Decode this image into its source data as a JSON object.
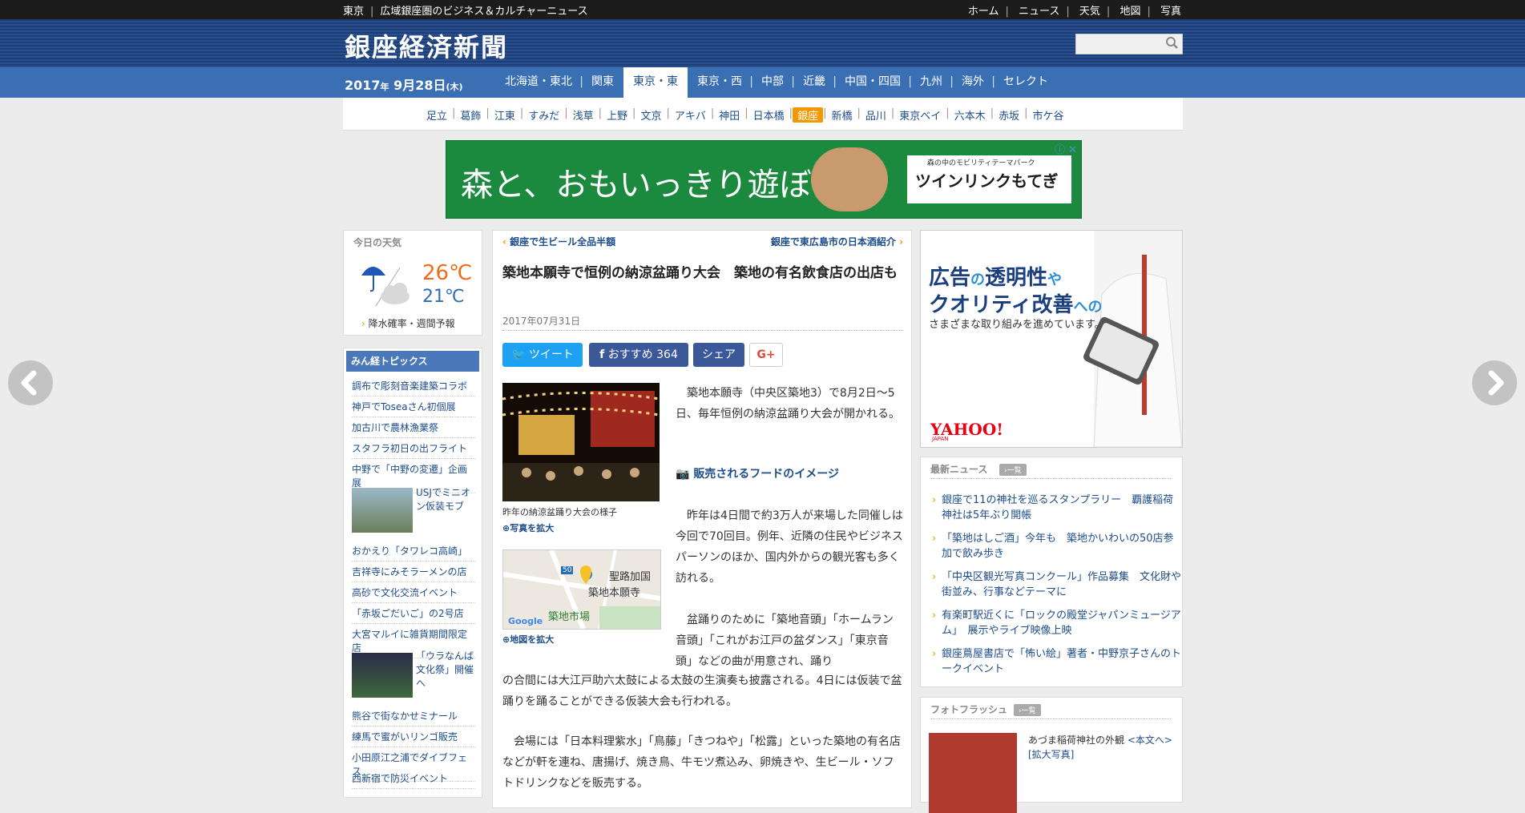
{
  "topbar": {
    "region": "東京",
    "tagline": "広域銀座圏のビジネス＆カルチャーニュース",
    "links": [
      "ホーム",
      "ニュース",
      "天気",
      "地図",
      "写真"
    ]
  },
  "site": {
    "title": "銀座経済新聞"
  },
  "date": {
    "year": "2017",
    "nen": "年",
    "md": " 9月28日",
    "dow": "(木)"
  },
  "regions": [
    "北海道・東北",
    "関東",
    "東京・東",
    "東京・西",
    "中部",
    "近畿",
    "中国・四国",
    "九州",
    "海外",
    "セレクト"
  ],
  "areas": [
    "足立",
    "葛飾",
    "江東",
    "すみだ",
    "浅草",
    "上野",
    "文京",
    "アキバ",
    "神田",
    "日本橋",
    "銀座",
    "新橋",
    "品川",
    "東京ベイ",
    "六本木",
    "赤坂",
    "市ケ谷"
  ],
  "banner": {
    "text": "森と、おもいっきり遊ぼう。",
    "sub": "森の中のモビリティテーマパーク",
    "brand": "ツインリンクもてぎ"
  },
  "weather": {
    "title": "今日の天気",
    "high": "26℃",
    "low": "21℃",
    "link": "降水確率・週間予報"
  },
  "topics": {
    "title": "みん経トピックス",
    "items_a": [
      "調布で彫刻音楽建築コラボ",
      "神戸でToseaさん初個展",
      "加古川で農林漁業祭",
      "スタフラ初日の出フライト",
      "中野で「中野の変遷」企画展"
    ],
    "img1": "USJでミニオン仮装モブ",
    "items_b": [
      "おかえり「タワレコ高崎」",
      "吉祥寺にみそラーメンの店",
      "高砂で文化交流イベント",
      "「赤坂ごだいご」の2号店",
      "大宮マルイに雑貨期間限定店"
    ],
    "img2": "「ウラなんば文化祭」開催へ",
    "items_c": [
      "熊谷で街なかせミナール",
      "練馬で蜜がいリンゴ販売",
      "小田原江之浦でダイブフェス",
      "西新宿で防災イベント"
    ]
  },
  "article": {
    "prev": "銀座で生ビール全品半額",
    "next": "銀座で東広島市の日本酒紹介",
    "title": "築地本願寺で恒例の納涼盆踊り大会　築地の有名飲食店の出店も",
    "date": "2017年07月31日",
    "tweet": "ツイート",
    "recommend": "おすすめ 364",
    "share": "シェア",
    "gplus": "G+",
    "photo_caption": "昨年の納涼盆踊り大会の様子",
    "photo_zoom": "写真を拡大",
    "map_zoom": "地図を拡大",
    "map_labels": [
      "聖路加国",
      "築地本願寺",
      "築地市場",
      "50",
      "Google"
    ],
    "p1": "　築地本願寺（中央区築地3）で8月2日～5日、毎年恒例の納涼盆踊り大会が開かれる。",
    "food_link": "販売されるフードのイメージ",
    "p2": "　昨年は4日間で約3万人が来場した同催しは今回で70回目。例年、近隣の住民やビジネスパーソンのほか、国内外からの観光客も多く訪れる。",
    "p3": "　盆踊りのために「築地音頭」「ホームラン音頭」「これがお江戸の盆ダンス」「東京音頭」などの曲が用意され、踊り",
    "p3b": "の合間には大江戸助六太鼓による太鼓の生演奏も披露される。4日には仮装で盆踊りを踊ることができる仮装大会も行われる。",
    "p4": "　会場には「日本料理紫水」「鳥藤」「きつねや」「松露」といった築地の有名店などが軒を連ね、唐揚げ、焼き鳥、牛モツ煮込み、卵焼きや、生ビール・ソフトドリンクなどを販売する。"
  },
  "ad": {
    "l1a": "広告",
    "l1b": "の",
    "l1c": "透明性",
    "l1d": "や",
    "l2a": "クオリティ改善",
    "l2b": "への",
    "l3": "さまざまな取り組みを進めています。",
    "brand": "YAHOO!",
    "brand_sub": "JAPAN"
  },
  "latest": {
    "title": "最新ニュース",
    "more": "一覧",
    "items": [
      "銀座で11の神社を巡るスタンプラリー　覇護稲荷神社は5年ぶり開帳",
      "「築地はしご酒」今年も　築地かいわいの50店参加で飲み歩き",
      "「中央区観光写真コンクール」作品募集　文化財や街並み、行事などテーマに",
      "有楽町駅近くに「ロックの殿堂ジャパンミュージアム」　展示やライブ映像上映",
      "銀座蔦屋書店で「怖い絵」著者・中野京子さんのトークイベント"
    ]
  },
  "photoflash": {
    "title": "フォトフラッシュ",
    "more": "一覧",
    "caption": "あづま稲荷神社の外観",
    "link": "<本文へ>",
    "zoom": "[拡大写真]"
  },
  "colors": {
    "brand_blue": "#3a6fb3",
    "header_navy": "#1d3e76",
    "accent_orange": "#f39800",
    "link": "#1d4d8a"
  }
}
